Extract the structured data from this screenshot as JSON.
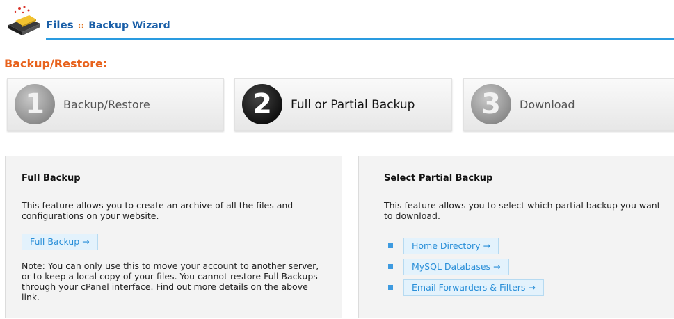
{
  "header": {
    "title": "Files",
    "separator": "::",
    "subtitle": "Backup Wizard",
    "icon": "backup-drive-icon"
  },
  "section_title": "Backup/Restore:",
  "steps": [
    {
      "number": "1",
      "label": "Backup/Restore",
      "state": "inactive"
    },
    {
      "number": "2",
      "label": "Full or Partial Backup",
      "state": "active"
    },
    {
      "number": "3",
      "label": "Download",
      "state": "inactive"
    }
  ],
  "full_backup": {
    "title": "Full Backup",
    "description": "This feature allows you to create an archive of all the files and configurations on your website.",
    "button": "Full Backup →",
    "note": "Note: You can only use this to move your account to another server, or to keep a local copy of your files. You cannot restore Full Backups through your cPanel interface. Find out more details on the above link."
  },
  "partial_backup": {
    "title": "Select Partial Backup",
    "description": "This feature allows you to select which partial backup you want to download.",
    "links": [
      "Home Directory →",
      "MySQL Databases →",
      "Email Forwarders & Filters →"
    ]
  },
  "colors": {
    "accent_blue": "#2a9be0",
    "section_orange": "#e8621c",
    "link_blue": "#2a8fd8"
  }
}
